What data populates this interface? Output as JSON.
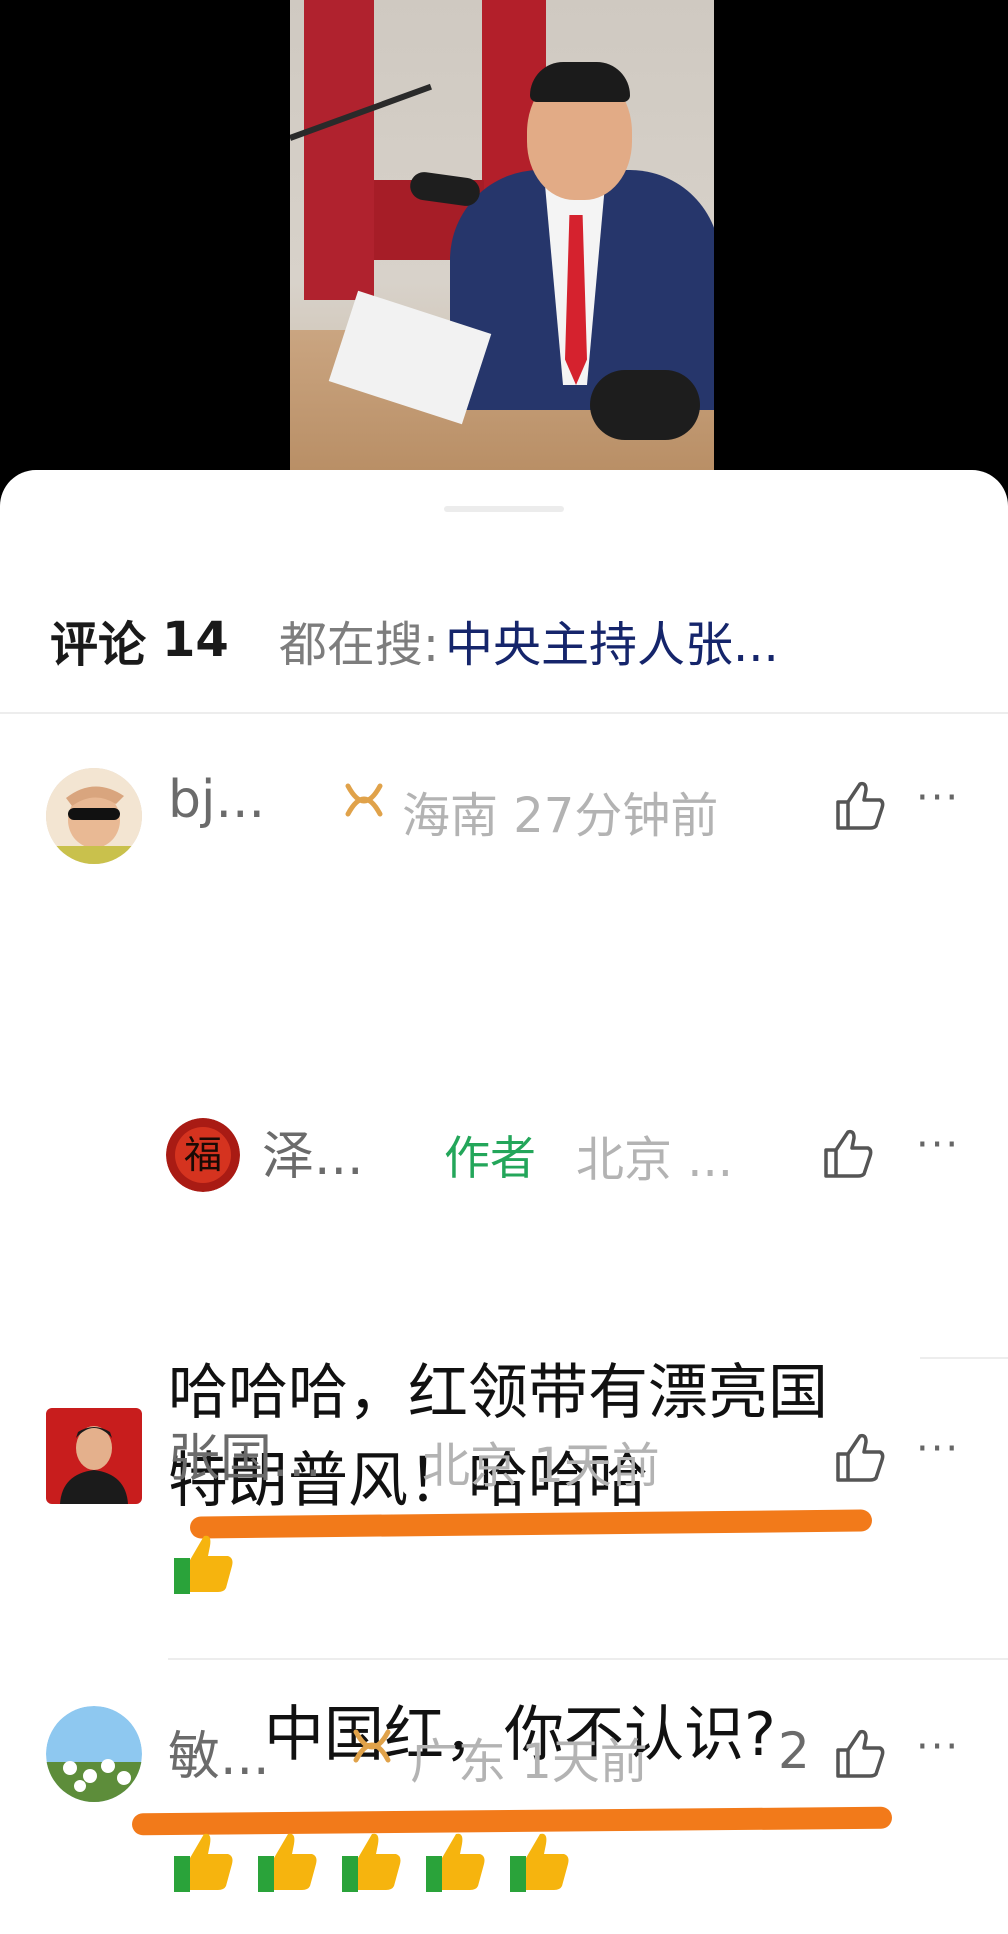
{
  "video": {
    "description_icon": "video-frame"
  },
  "header": {
    "title": "评论",
    "count": "14",
    "search_prefix": "都在搜:",
    "search_term": "中央主持人张..."
  },
  "comments": [
    {
      "name": "bj...",
      "badge_icon": "v-badge-icon",
      "region_time": "海南 27分钟前",
      "text_line1": "哈哈哈，红领带有漂亮国",
      "text_line2": "特朗普风！哈哈哈",
      "more": "···"
    },
    {
      "name": "泽...",
      "author_tag": "作者",
      "region_time": "北京 ...",
      "text": "中国红，你不认识?",
      "more": "···"
    },
    {
      "name": "张国...",
      "region_time": "北京 1天前",
      "more": "···",
      "reaction_count": 1
    },
    {
      "name": "敏...",
      "badge_icon": "v-badge-icon",
      "region_time": "广东 1天前",
      "like_count": "2",
      "more": "···",
      "reaction_count": 5
    }
  ],
  "colors": {
    "underline": "#f27a1a",
    "author_tag": "#23a65a",
    "search_term": "#15256b",
    "badge": "#e0a24a"
  }
}
